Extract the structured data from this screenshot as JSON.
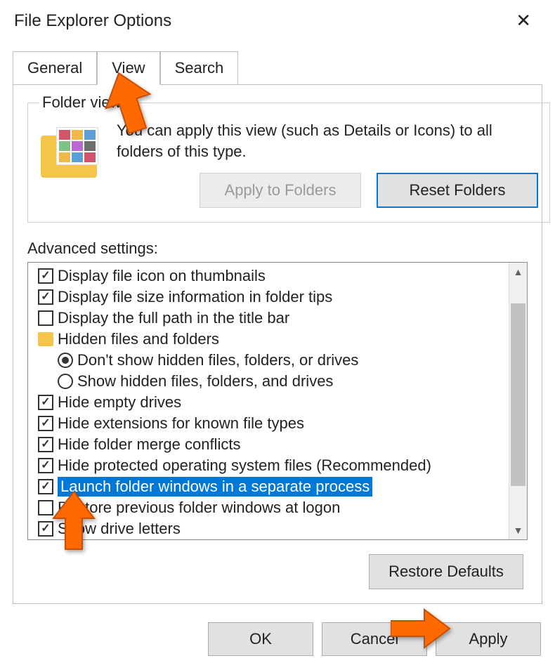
{
  "window": {
    "title": "File Explorer Options"
  },
  "tabs": {
    "general": "General",
    "view": "View",
    "search": "Search"
  },
  "folder_views": {
    "legend": "Folder views",
    "description": "You can apply this view (such as Details or Icons) to all folders of this type.",
    "apply_to_folders": "Apply to Folders",
    "reset_folders": "Reset Folders"
  },
  "advanced": {
    "label": "Advanced settings:",
    "items": [
      {
        "kind": "check",
        "checked": true,
        "label": "Display file icon on thumbnails"
      },
      {
        "kind": "check",
        "checked": true,
        "label": "Display file size information in folder tips"
      },
      {
        "kind": "check",
        "checked": false,
        "label": "Display the full path in the title bar"
      },
      {
        "kind": "group",
        "label": "Hidden files and folders"
      },
      {
        "kind": "radio",
        "checked": true,
        "label": "Don't show hidden files, folders, or drives"
      },
      {
        "kind": "radio",
        "checked": false,
        "label": "Show hidden files, folders, and drives"
      },
      {
        "kind": "check",
        "checked": true,
        "label": "Hide empty drives"
      },
      {
        "kind": "check",
        "checked": true,
        "label": "Hide extensions for known file types"
      },
      {
        "kind": "check",
        "checked": true,
        "label": "Hide folder merge conflicts"
      },
      {
        "kind": "check",
        "checked": true,
        "label": "Hide protected operating system files (Recommended)"
      },
      {
        "kind": "check",
        "checked": true,
        "selected": true,
        "label": "Launch folder windows in a separate process"
      },
      {
        "kind": "check",
        "checked": false,
        "label": "Restore previous folder windows at logon"
      },
      {
        "kind": "check",
        "checked": true,
        "label": "Show drive letters"
      }
    ]
  },
  "buttons": {
    "restore_defaults": "Restore Defaults",
    "ok": "OK",
    "cancel": "Cancel",
    "apply": "Apply"
  }
}
